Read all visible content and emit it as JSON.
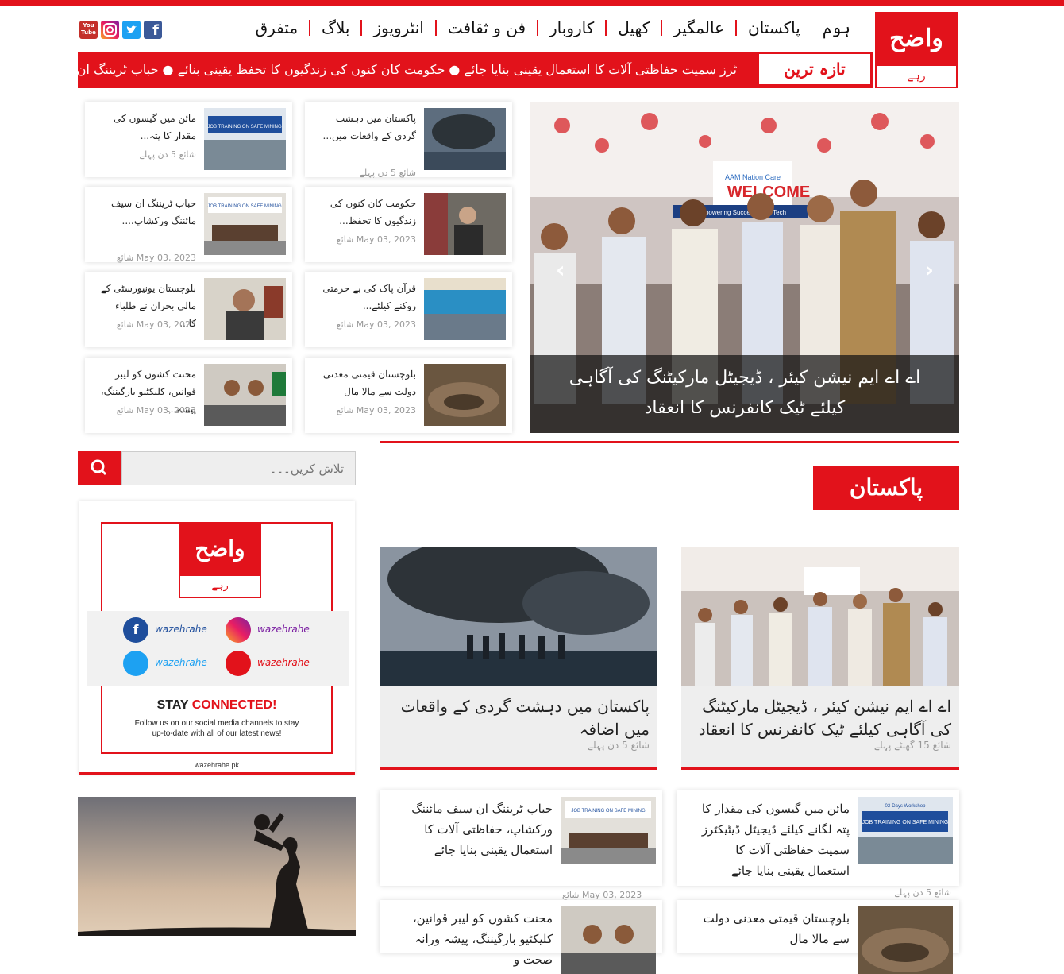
{
  "brand": {
    "logo_top": "واضح",
    "logo_bottom": "رہے"
  },
  "nav": [
    "ہوم",
    "پاکستان",
    "عالمگیر",
    "کھیل",
    "کاروبار",
    "فن و ثقافت",
    "انٹرویوز",
    "بلاگ",
    "متفرق"
  ],
  "social": {
    "youtube": "You Tube",
    "instagram_icon": "instagram-icon",
    "twitter_icon": "twitter-icon",
    "facebook_icon": "facebook-icon"
  },
  "ticker": {
    "label": "تازہ ترین",
    "text": "ٹرز سمیت حفاظتی آلات کا استعمال یقینی بنایا جائے  ●  حکومت کان کنوں کی زندگیوں کا تحفظ یقینی بنائے  ●  حباب ٹریننگ ان سیف"
  },
  "slider": {
    "caption": "اے اے ایم نیشن کیئر ، ڈیجیٹل مارکیٹنگ کی آگاہی کیلئے ٹیک کانفرنس کا انعقاد",
    "sign": "WELCOME",
    "sign_org": "AAM Nation Care",
    "sign_tagline": "Empowering Success With Tech"
  },
  "cards": [
    {
      "title": "پاکستان میں دہشت گردی کے واقعات میں...",
      "meta": "شائع 5 دن پہلے"
    },
    {
      "title": "مائن میں گیسوں کی مقدار کا پتہ...",
      "meta": "شائع 5 دن پہلے"
    },
    {
      "title": "حکومت کان کنوں کی زندگیوں کا تحفظ...",
      "meta": "May 03, 2023 شائع"
    },
    {
      "title": "حباب ٹریننگ ان سیف مائننگ ورکشاپ،...",
      "meta": "May 03, 2023 شائع"
    },
    {
      "title": "قرآن پاک کی بے حرمتی روکنے کیلئے...",
      "meta": "May 03, 2023 شائع"
    },
    {
      "title": "بلوچستان یونیورسٹی کے مالی بحران نے طلباء کا...",
      "meta": "May 03, 2023 شائع"
    },
    {
      "title": "بلوچستان قیمتی معدنی دولت سے مالا مال",
      "meta": "May 03, 2023 شائع"
    },
    {
      "title": "محنت کشوں کو لیبر قوانین، کلیکٹیو بارگیننگ، پیشہ...",
      "meta": "May 03, 2023 شائع"
    }
  ],
  "section": {
    "title": "پاکستان"
  },
  "search": {
    "placeholder": "تلاش کریں۔۔۔"
  },
  "promo": {
    "facebook": "wazehrahe",
    "instagram": "wazehrahe",
    "twitter": "wazehrahe",
    "youtube": "wazehrahe",
    "stay": "STAY",
    "connected": "CONNECTED!",
    "line1": "Follow us on our social media channels to stay",
    "line2": "up-to-date with all of our latest news!",
    "url": "wazehrahe.pk"
  },
  "big": [
    {
      "title": "اے اے ایم نیشن کیئر ، ڈیجیٹل مارکیٹنگ کی آگاہی کیلئے ٹیک کانفرنس کا انعقاد",
      "meta": "شائع 15 گھنٹے پہلے"
    },
    {
      "title": "پاکستان میں دہشت گردی کے واقعات میں اضافہ",
      "meta": "شائع 5 دن پہلے"
    }
  ],
  "list": [
    {
      "title": "مائن میں گیسوں کی مقدار کا پتہ لگانے کیلئے ڈیجیٹل ڈیٹیکٹرز سمیت حفاظتی آلات کا استعمال یقینی بنایا جائے",
      "meta": "شائع 5 دن پہلے"
    },
    {
      "title": "حباب ٹریننگ ان سیف مائننگ ورکشاپ، حفاظتی آلات کا استعمال یقینی بنایا جائے",
      "meta": "May 03, 2023 شائع"
    },
    {
      "title": "بلوچستان قیمتی معدنی دولت سے مالا مال",
      "meta": ""
    },
    {
      "title": "محنت کشوں کو لیبر قوانین، کلیکٹیو بارگیننگ، پیشہ ورانہ صحت و",
      "meta": ""
    }
  ],
  "thumb_text": {
    "workshop": "JOB TRAINING ON SAFE MINING",
    "workshop_sub": "02-Days Workshop"
  },
  "colors": {
    "accent": "#e2121b"
  }
}
